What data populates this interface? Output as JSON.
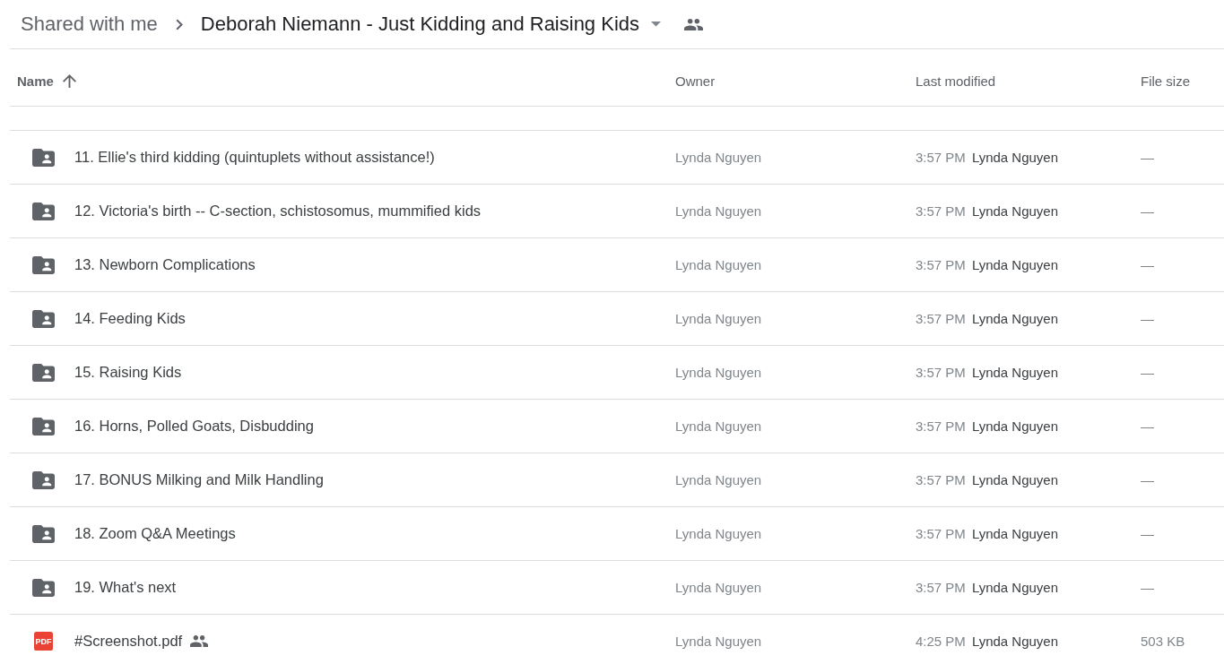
{
  "breadcrumb": {
    "parent": "Shared with me",
    "current": "Deborah Niemann - Just Kidding and Raising Kids"
  },
  "table": {
    "columns": [
      {
        "label": "Name",
        "sorted": true
      },
      {
        "label": "Owner",
        "sorted": false
      },
      {
        "label": "Last modified",
        "sorted": false
      },
      {
        "label": "File size",
        "sorted": false
      }
    ],
    "rows": [
      {
        "kind": "folder",
        "name": "11. Ellie's third kidding (quintuplets without assistance!)",
        "shared": false,
        "owner": "Lynda Nguyen",
        "modified_time": "3:57 PM",
        "modified_by": "Lynda Nguyen",
        "size": "—"
      },
      {
        "kind": "folder",
        "name": "12. Victoria's birth -- C-section, schistosomus, mummified kids",
        "shared": false,
        "owner": "Lynda Nguyen",
        "modified_time": "3:57 PM",
        "modified_by": "Lynda Nguyen",
        "size": "—"
      },
      {
        "kind": "folder",
        "name": "13. Newborn Complications",
        "shared": false,
        "owner": "Lynda Nguyen",
        "modified_time": "3:57 PM",
        "modified_by": "Lynda Nguyen",
        "size": "—"
      },
      {
        "kind": "folder",
        "name": "14. Feeding Kids",
        "shared": false,
        "owner": "Lynda Nguyen",
        "modified_time": "3:57 PM",
        "modified_by": "Lynda Nguyen",
        "size": "—"
      },
      {
        "kind": "folder",
        "name": "15. Raising Kids",
        "shared": false,
        "owner": "Lynda Nguyen",
        "modified_time": "3:57 PM",
        "modified_by": "Lynda Nguyen",
        "size": "—"
      },
      {
        "kind": "folder",
        "name": "16. Horns, Polled Goats, Disbudding",
        "shared": false,
        "owner": "Lynda Nguyen",
        "modified_time": "3:57 PM",
        "modified_by": "Lynda Nguyen",
        "size": "—"
      },
      {
        "kind": "folder",
        "name": "17. BONUS Milking and Milk Handling",
        "shared": false,
        "owner": "Lynda Nguyen",
        "modified_time": "3:57 PM",
        "modified_by": "Lynda Nguyen",
        "size": "—"
      },
      {
        "kind": "folder",
        "name": "18. Zoom Q&A Meetings",
        "shared": false,
        "owner": "Lynda Nguyen",
        "modified_time": "3:57 PM",
        "modified_by": "Lynda Nguyen",
        "size": "—"
      },
      {
        "kind": "folder",
        "name": "19. What's next",
        "shared": false,
        "owner": "Lynda Nguyen",
        "modified_time": "3:57 PM",
        "modified_by": "Lynda Nguyen",
        "size": "—"
      },
      {
        "kind": "pdf",
        "icon_text": "PDF",
        "name": "#Screenshot.pdf",
        "shared": true,
        "owner": "Lynda Nguyen",
        "modified_time": "4:25 PM",
        "modified_by": "Lynda Nguyen",
        "size": "503 KB"
      }
    ]
  }
}
